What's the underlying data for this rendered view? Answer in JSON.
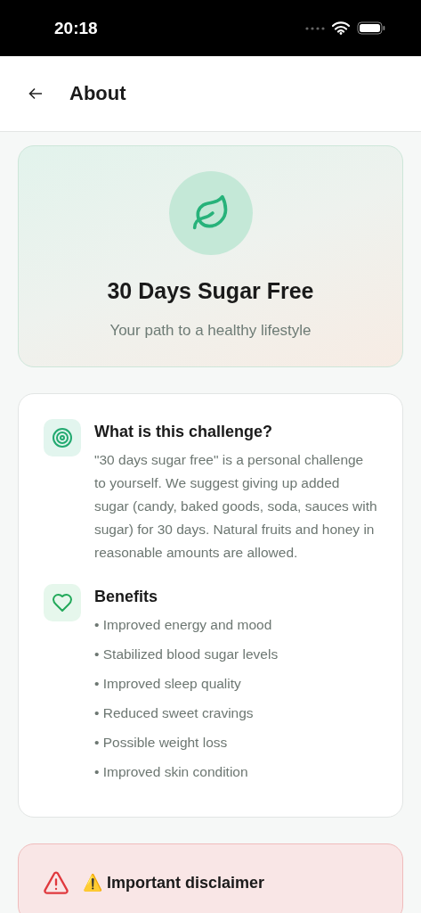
{
  "status_bar": {
    "time": "20:18"
  },
  "header": {
    "title": "About"
  },
  "hero": {
    "title": "30 Days Sugar Free",
    "subtitle": "Your path to a healthy lifestyle"
  },
  "sections": [
    {
      "kind": "text",
      "title": "What is this challenge?",
      "body": "\"30 days sugar free\" is a personal challenge to yourself. We suggest giving up added sugar (candy, baked goods, soda, sauces with sugar) for 30 days. Natural fruits and honey in reasonable amounts are allowed."
    },
    {
      "kind": "list",
      "title": "Benefits",
      "items": [
        "• Improved energy and mood",
        "• Stabilized blood sugar levels",
        "• Improved sleep quality",
        "• Reduced sweet cravings",
        "• Possible weight loss",
        "• Improved skin condition"
      ]
    }
  ],
  "disclaimer": {
    "title": "⚠️ Important disclaimer"
  }
}
